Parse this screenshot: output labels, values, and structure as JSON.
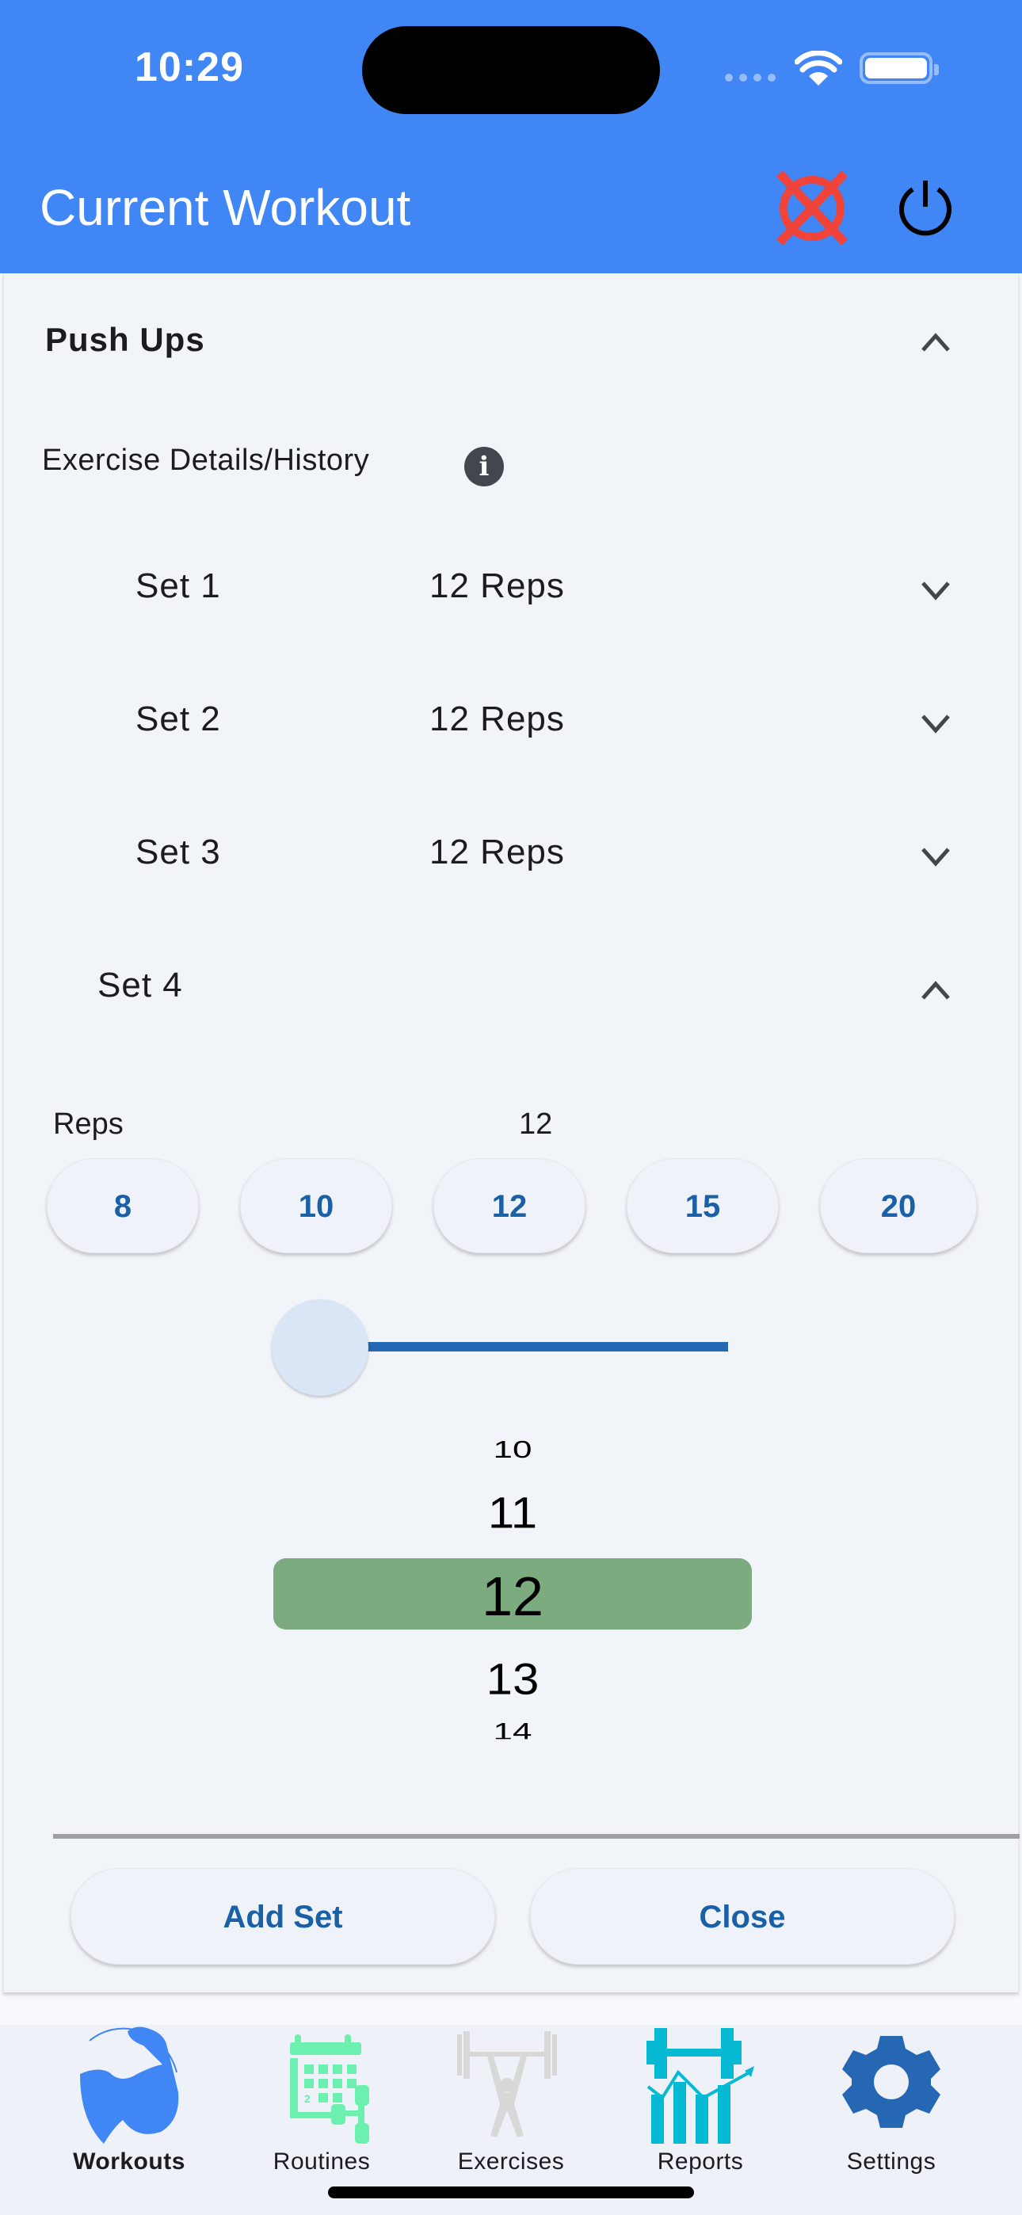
{
  "status_bar": {
    "time": "10:29"
  },
  "header": {
    "title": "Current Workout",
    "cancel_icon": "cancel-workout-icon",
    "power_icon": "power-icon",
    "background": "#4086f4"
  },
  "exercise": {
    "name": "Push Ups",
    "details_link": "Exercise Details/History",
    "info_icon_glyph": "i"
  },
  "sets": [
    {
      "label": "Set 1",
      "reps": "12 Reps",
      "expanded": false
    },
    {
      "label": "Set 2",
      "reps": "12 Reps",
      "expanded": false
    },
    {
      "label": "Set 3",
      "reps": "12 Reps",
      "expanded": false
    },
    {
      "label": "Set 4",
      "reps": "",
      "expanded": true
    }
  ],
  "editor": {
    "reps_label": "Reps",
    "reps_value": "12",
    "quick_picks": [
      "8",
      "10",
      "12",
      "15",
      "20"
    ],
    "slider_fraction": 0.0,
    "picker": {
      "items": [
        "10",
        "11",
        "12",
        "13",
        "14"
      ],
      "selected": "12",
      "highlight_color": "#7dab80"
    }
  },
  "actions": {
    "add_set": "Add Set",
    "close": "Close"
  },
  "tabbar": {
    "tabs": [
      {
        "label": "Workouts",
        "icon": "flexed-arm-icon",
        "active": true,
        "color": "#4086f4"
      },
      {
        "label": "Routines",
        "icon": "calendar-dumbbell-icon",
        "active": false,
        "color": "#6cf0b0"
      },
      {
        "label": "Exercises",
        "icon": "weightlifter-icon",
        "active": false,
        "color": "#d8d8d8"
      },
      {
        "label": "Reports",
        "icon": "dumbbell-chart-icon",
        "active": false,
        "color": "#07b9d3"
      },
      {
        "label": "Settings",
        "icon": "gear-icon",
        "active": false,
        "color": "#2567b3"
      }
    ]
  },
  "colors": {
    "accent_text": "#1960a6",
    "cancel_red": "#f0443a",
    "card_bg": "#f1f4f9"
  }
}
